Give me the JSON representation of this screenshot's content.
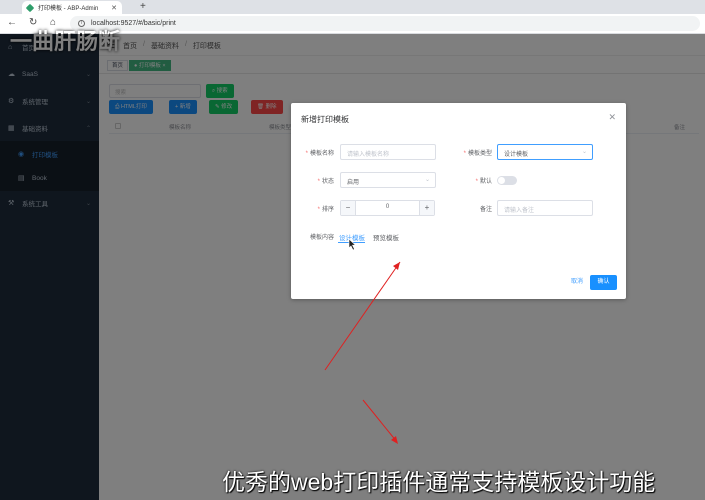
{
  "browser": {
    "tab_title": "打印模板 - ABP-Admin",
    "url": "localhost:9527/#/basic/print"
  },
  "banner_text": "一曲肝肠断",
  "sidebar": {
    "items": [
      {
        "label": "首页",
        "icon": "home-icon"
      },
      {
        "label": "SaaS",
        "icon": "cloud-icon"
      },
      {
        "label": "系统管理",
        "icon": "gear-icon"
      },
      {
        "label": "基础资料",
        "icon": "folder-icon"
      },
      {
        "label": "打印模板",
        "icon": "print-icon"
      },
      {
        "label": "Book",
        "icon": "book-icon"
      },
      {
        "label": "系统工具",
        "icon": "tool-icon"
      }
    ]
  },
  "header": {
    "breadcrumb": [
      "首页",
      "基础资料",
      "打印模板"
    ]
  },
  "tags": [
    "首页",
    "打印模板"
  ],
  "toolbar": {
    "search_placeholder": "搜索",
    "search_btn": "搜索",
    "html_print_btn": "HTML打印",
    "add_btn": "新增",
    "edit_btn": "修改",
    "delete_btn": "删除"
  },
  "table": {
    "headers": [
      "模板名称",
      "模板类型",
      "备注"
    ]
  },
  "dialog": {
    "title": "新增打印模板",
    "name_label": "模板名称",
    "name_placeholder": "请输入模板名称",
    "type_label": "模板类型",
    "type_value": "设计模板",
    "status_label": "状态",
    "status_value": "启用",
    "default_label": "默认",
    "sort_label": "排序",
    "sort_value": "0",
    "remark_label": "备注",
    "remark_placeholder": "请输入备注",
    "content_label": "模板内容",
    "tab_design": "设计模板",
    "tab_preview": "预览模板",
    "cancel_label": "取消",
    "confirm_label": "确认"
  },
  "caption": "优秀的web打印插件通常支持模板设计功能",
  "colors": {
    "primary": "#1890ff",
    "sidebar": "#1f2d3d",
    "annotation_red": "#e02020"
  }
}
